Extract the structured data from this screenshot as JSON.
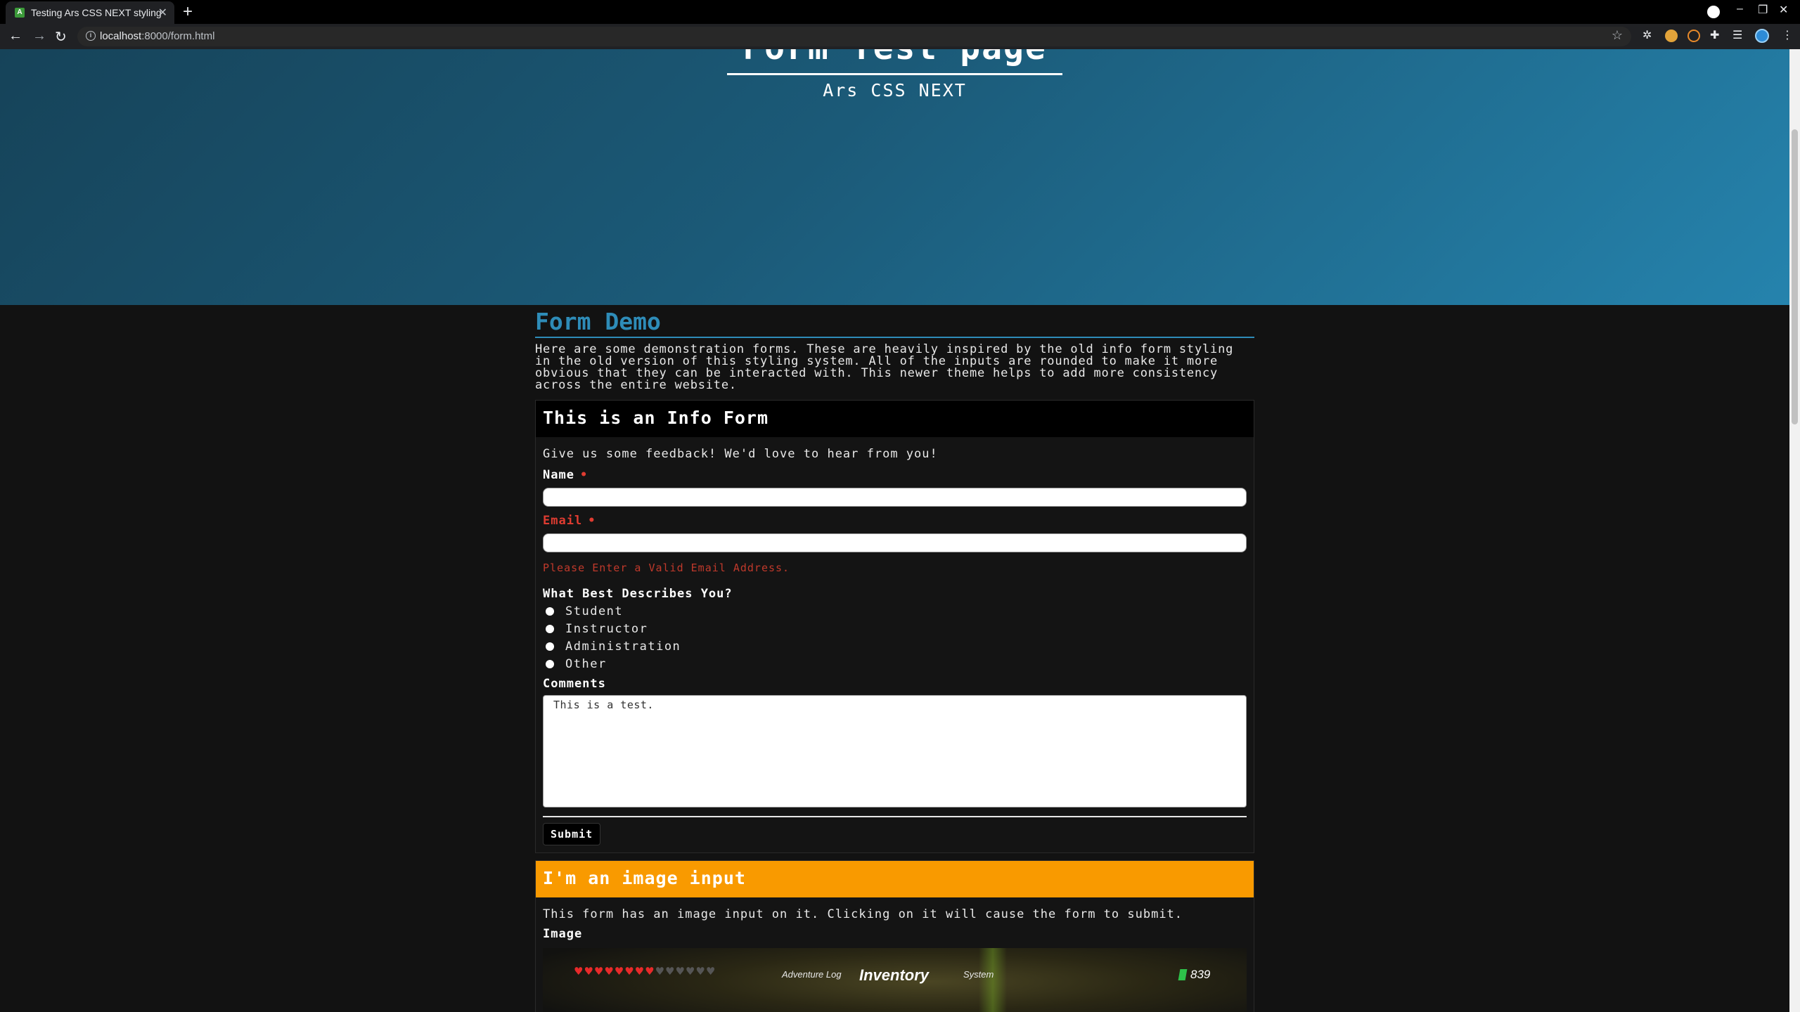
{
  "browser": {
    "tab_title": "Testing Ars CSS NEXT styling",
    "favicon_letter": "A",
    "url_host": "localhost",
    "url_rest": ":8000/form.html"
  },
  "hero": {
    "title": "Form Test page",
    "subtitle": "Ars CSS NEXT"
  },
  "main": {
    "section_title": "Form Demo",
    "intro_lines": [
      "Here are some demonstration forms. These are heavily inspired by the old info form styling",
      "in the old version of this styling system. All of the inputs are rounded to make it more",
      "obvious that they can be interacted with. This newer theme helps to add more consistency",
      "across the entire website."
    ]
  },
  "info_form": {
    "heading": "This is an Info Form",
    "lead": "Give us some feedback! We'd love to hear from you!",
    "name_label": "Name",
    "email_label": "Email",
    "required_marker": "•",
    "email_error": "Please Enter a Valid Email Address.",
    "describe_label": "What Best Describes You?",
    "options": [
      "Student",
      "Instructor",
      "Administration",
      "Other"
    ],
    "comments_label": "Comments",
    "comments_value": "This is a test.",
    "submit_label": "Submit"
  },
  "image_form": {
    "heading": "I'm an image input",
    "lead": "This form has an image input on it. Clicking on it will cause the form to submit.",
    "image_label": "Image",
    "image_content": {
      "left_tab": "Adventure Log",
      "center_title": "Inventory",
      "right_tab": "System",
      "rupee_count": "839"
    }
  },
  "colors": {
    "accent": "#2e8cb8",
    "error": "#e03c31",
    "orange_header": "#f99a00"
  }
}
